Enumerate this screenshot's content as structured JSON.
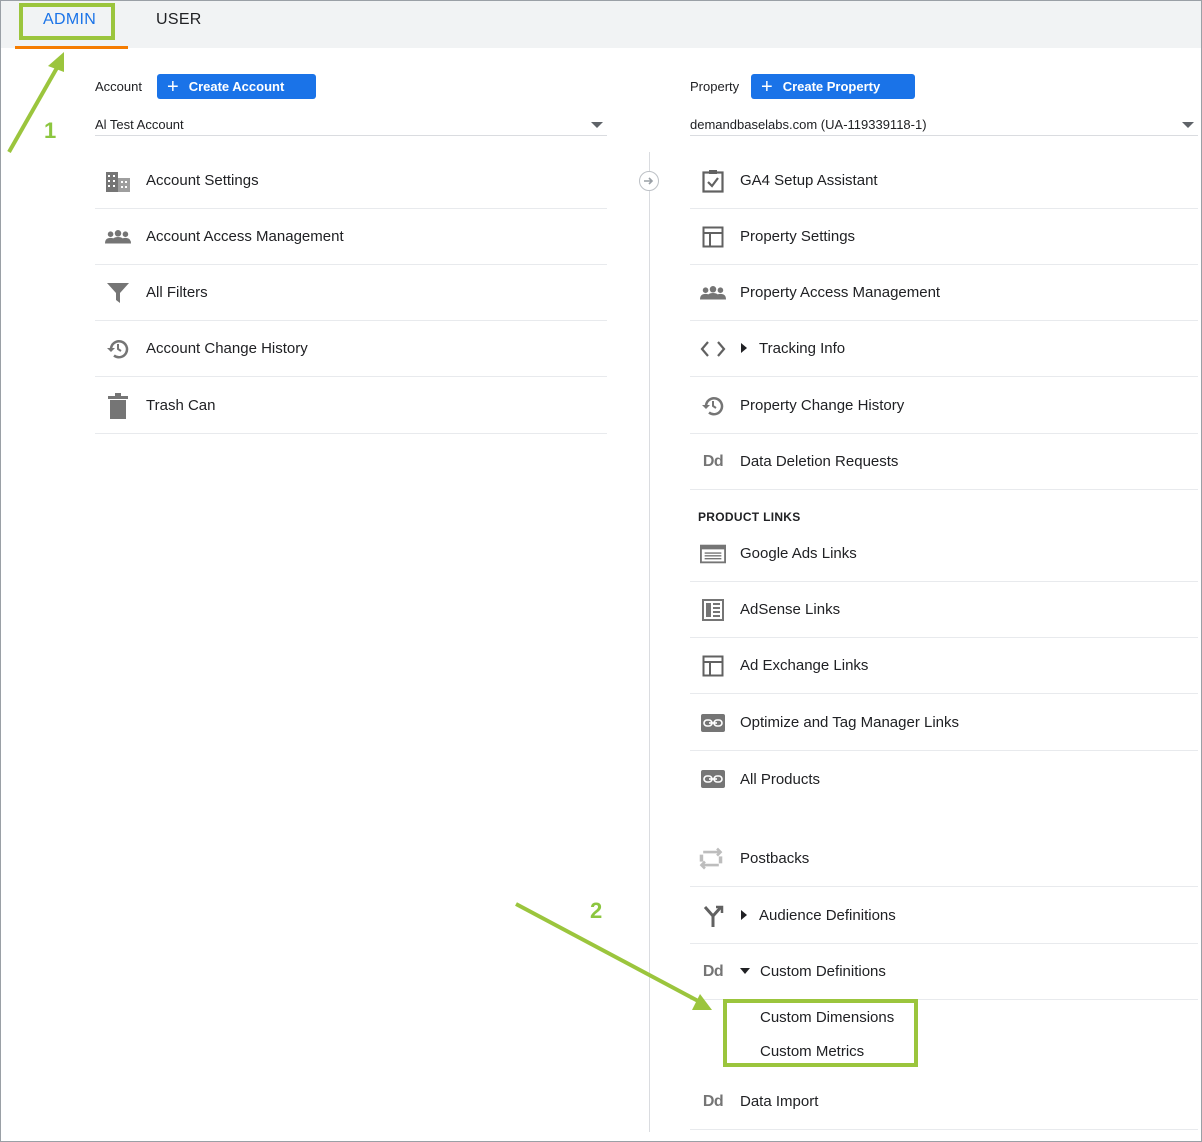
{
  "tabs": {
    "admin": "ADMIN",
    "user": "USER"
  },
  "account": {
    "label": "Account",
    "create_button": "Create Account",
    "selected": "Al Test Account",
    "items": [
      {
        "label": "Account Settings",
        "icon": "building-icon"
      },
      {
        "label": "Account Access Management",
        "icon": "people-icon"
      },
      {
        "label": "All Filters",
        "icon": "filter-icon"
      },
      {
        "label": "Account Change History",
        "icon": "history-icon"
      },
      {
        "label": "Trash Can",
        "icon": "trash-icon"
      }
    ]
  },
  "property": {
    "label": "Property",
    "create_button": "Create Property",
    "selected": "demandbaselabs.com (UA-119339118-1)",
    "items": [
      {
        "label": "GA4 Setup Assistant",
        "icon": "checklist-icon"
      },
      {
        "label": "Property Settings",
        "icon": "layout-icon"
      },
      {
        "label": "Property Access Management",
        "icon": "people-icon"
      },
      {
        "label": "Tracking Info",
        "icon": "code-icon"
      },
      {
        "label": "Property Change History",
        "icon": "history-icon"
      },
      {
        "label": "Data Deletion Requests",
        "icon": "dd-icon"
      }
    ],
    "product_links_heading": "PRODUCT LINKS",
    "product_links": [
      {
        "label": "Google Ads Links",
        "icon": "ads-icon"
      },
      {
        "label": "AdSense Links",
        "icon": "adsense-icon"
      },
      {
        "label": "Ad Exchange Links",
        "icon": "layout-icon"
      },
      {
        "label": "Optimize and Tag Manager Links",
        "icon": "link-icon"
      },
      {
        "label": "All Products",
        "icon": "link-icon"
      }
    ],
    "more_items": [
      {
        "label": "Postbacks",
        "icon": "postbacks-icon"
      },
      {
        "label": "Audience Definitions",
        "icon": "audience-icon"
      },
      {
        "label": "Custom Definitions",
        "icon": "dd-icon"
      }
    ],
    "custom_definitions_sub": [
      "Custom Dimensions",
      "Custom Metrics"
    ],
    "data_import": "Data Import",
    "dd_glyph": "Dd"
  },
  "annotations": {
    "step1": "1",
    "step2": "2",
    "highlight_color": "#9bc53d"
  }
}
